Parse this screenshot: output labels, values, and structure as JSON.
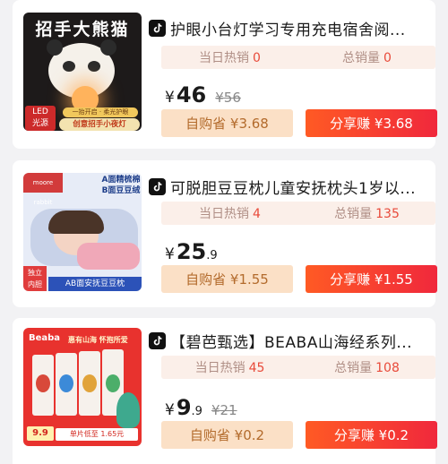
{
  "products": [
    {
      "title": "护眼小台灯学习专用充电宿舍阅...",
      "daily_sales_label": "当日热销",
      "daily_sales": "0",
      "total_sales_label": "总销量",
      "total_sales": "0",
      "currency": "¥",
      "price_int": "46",
      "price_dec": "",
      "old_price": "¥56",
      "self_buy_label": "自购省 ¥3.68",
      "share_label": "分享赚 ¥3.68",
      "image_text": {
        "banner": "招手大熊猫",
        "led": "LED",
        "led2": "光源",
        "tag1": "一抬开启 · 柔光护眼",
        "tag2": "创意招手小夜灯"
      }
    },
    {
      "title": "可脱胆豆豆枕儿童安抚枕头1岁以...",
      "daily_sales_label": "当日热销",
      "daily_sales": "4",
      "total_sales_label": "总销量",
      "total_sales": "135",
      "currency": "¥",
      "price_int": "25",
      "price_dec": ".9",
      "old_price": "",
      "self_buy_label": "自购省 ¥1.55",
      "share_label": "分享赚 ¥1.55",
      "image_text": {
        "brand": "moore rabbit",
        "a_side": "A面精梳棉",
        "b_side": "B面豆豆绒",
        "inner": "独立",
        "inner2": "内胆",
        "bottom": "AB面安抚豆豆枕"
      }
    },
    {
      "title": "【碧芭甄选】BEABA山海经系列...",
      "daily_sales_label": "当日热销",
      "daily_sales": "45",
      "total_sales_label": "总销量",
      "total_sales": "108",
      "currency": "¥",
      "price_int": "9",
      "price_dec": ".9",
      "old_price": "¥21",
      "self_buy_label": "自购省 ¥0.2",
      "share_label": "分享赚 ¥0.2",
      "image_text": {
        "brand": "Beaba",
        "slogan": "惠有山海 怀抱所爱",
        "price": "9.9",
        "unit": "单片低至 1.65元"
      }
    }
  ],
  "colors": {
    "accent_red": "#e84a3a",
    "share_gradient_start": "#ff5a24",
    "share_gradient_end": "#f0283c",
    "self_buy_bg": "#fbe0c6",
    "stats_bg": "#fbefe9"
  },
  "icons": [
    "douyin-icon"
  ]
}
